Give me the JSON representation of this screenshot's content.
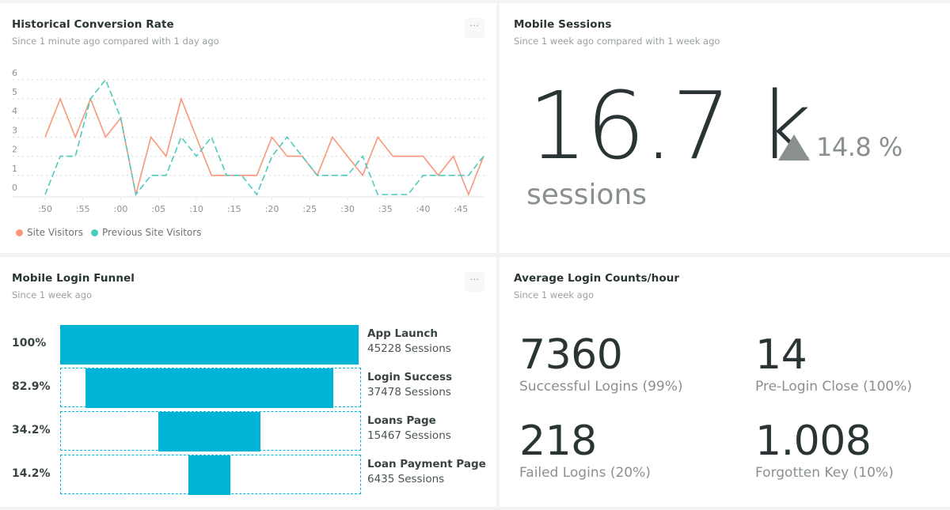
{
  "cards": {
    "conversion": {
      "title": "Historical Conversion Rate",
      "subtitle": "Since 1 minute ago compared with 1 day ago",
      "menu_label": "···"
    },
    "sessions": {
      "title": "Mobile Sessions",
      "subtitle": "Since 1 week ago compared with 1 week ago",
      "value": "16.7 k",
      "trend_direction": "up",
      "trend_value": "14.8 %",
      "unit": "sessions"
    },
    "funnel": {
      "title": "Mobile Login Funnel",
      "subtitle": "Since 1 week ago",
      "menu_label": "···",
      "steps": [
        {
          "percent": "100%",
          "fraction": 1.0,
          "label": "App Launch",
          "count": "45228 Sessions"
        },
        {
          "percent": "82.9%",
          "fraction": 0.829,
          "label": "Login Success",
          "count": "37478 Sessions"
        },
        {
          "percent": "34.2%",
          "fraction": 0.342,
          "label": "Loans Page",
          "count": "15467 Sessions"
        },
        {
          "percent": "14.2%",
          "fraction": 0.142,
          "label": "Loan Payment Page",
          "count": "6435 Sessions"
        }
      ]
    },
    "logins": {
      "title": "Average Login Counts/hour",
      "subtitle": "Since 1 week ago",
      "stats": [
        {
          "value": "7360",
          "label": "Successful Logins (99%)"
        },
        {
          "value": "14",
          "label": "Pre-Login Close (100%)"
        },
        {
          "value": "218",
          "label": "Failed Logins (20%)"
        },
        {
          "value": "1.008",
          "label": "Forgotten Key (10%)"
        }
      ]
    }
  },
  "colors": {
    "site_visitors": "#f99779",
    "previous_site_visitors": "#4ccbbd",
    "funnel": "#00b4d8"
  },
  "chart_data": {
    "type": "line",
    "title": "Historical Conversion Rate",
    "xlabel": "",
    "ylabel": "",
    "x": [
      ":50",
      ":52",
      ":54",
      ":56",
      ":58",
      ":00",
      ":02",
      ":04",
      ":06",
      ":08",
      ":10",
      ":12",
      ":14",
      ":16",
      ":18",
      ":20",
      ":22",
      ":24",
      ":26",
      ":28",
      ":30",
      ":32",
      ":34",
      ":36",
      ":38",
      ":40",
      ":42",
      ":44",
      ":46",
      ":48"
    ],
    "x_ticks": [
      ":50",
      ":55",
      ":00",
      ":05",
      ":10",
      ":15",
      ":20",
      ":25",
      ":30",
      ":35",
      ":40",
      ":45"
    ],
    "y_ticks": [
      0,
      1,
      2,
      3,
      4,
      5,
      6
    ],
    "ylim": [
      0,
      6
    ],
    "grid": true,
    "legend_position": "bottom-left",
    "series": [
      {
        "name": "Site Visitors",
        "style": "solid",
        "values": [
          3,
          5,
          3,
          5,
          3,
          4,
          0,
          3,
          2,
          5,
          3,
          1,
          1,
          1,
          1,
          3,
          2,
          2,
          1,
          3,
          2,
          1,
          3,
          2,
          2,
          2,
          1,
          2,
          0,
          2
        ]
      },
      {
        "name": "Previous Site Visitors",
        "style": "dashed",
        "values": [
          0,
          2,
          2,
          5,
          6,
          4,
          0,
          1,
          1,
          3,
          2,
          3,
          1,
          1,
          0,
          2,
          3,
          2,
          1,
          1,
          1,
          2,
          0,
          0,
          0,
          1,
          1,
          1,
          1,
          2
        ]
      }
    ]
  }
}
